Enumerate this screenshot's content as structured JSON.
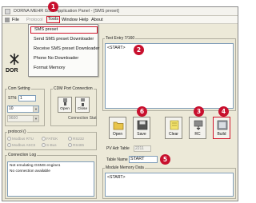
{
  "window": {
    "title": "DORNA MEHR GSM Application Panel - [SMS preset]"
  },
  "menu": {
    "file": "File",
    "protocol": "Protocol",
    "tools": "Tools",
    "window": "Window",
    "help": "Help",
    "about": "About"
  },
  "tools_menu": {
    "items": [
      "SMS preset",
      "Send SMS preset Downloader",
      "Receive SMS preset Downloader",
      "Phone No Downloader",
      "Format Memory"
    ]
  },
  "logo": {
    "text": "DOR"
  },
  "com_setting": {
    "legend": "Com Setting",
    "stn_label": "STN:",
    "stn_value": "1",
    "port_value": "10",
    "baud_value": "9600"
  },
  "cdm_port": {
    "legend": "CDM Port Connection",
    "open_label": "Open",
    "close_label": "Close",
    "status": "Connection Stat"
  },
  "protocol": {
    "legend": "protocol ()",
    "options": [
      "Modbus RTU",
      "FATEK",
      "RS232",
      "Modbus ASCII",
      "S-Bus",
      "RS485"
    ]
  },
  "connection_log": {
    "legend": "Connection Log",
    "text": "Not emulating GSMS engine1\nNo connection available"
  },
  "text_entry": {
    "legend": "Text Entry",
    "counter": "7/160",
    "content": "<START>"
  },
  "toolbar": {
    "open_label": "Open",
    "save_label": "Save",
    "clear_label": "Clear",
    "rc_label": "RC",
    "build_label": "Build"
  },
  "pv_adr_table": {
    "label": "PV Adr Table",
    "value": "2211"
  },
  "table_name": {
    "label": "Table Name",
    "value": "START"
  },
  "module_memory": {
    "legend": "Module Memory Data",
    "content": "<START>"
  },
  "badges": [
    "1",
    "2",
    "3",
    "4",
    "5",
    "6"
  ],
  "colors": {
    "annotation_red": "#c8102e",
    "window_bg": "#ece9d8",
    "field_border": "#7f9db9"
  }
}
